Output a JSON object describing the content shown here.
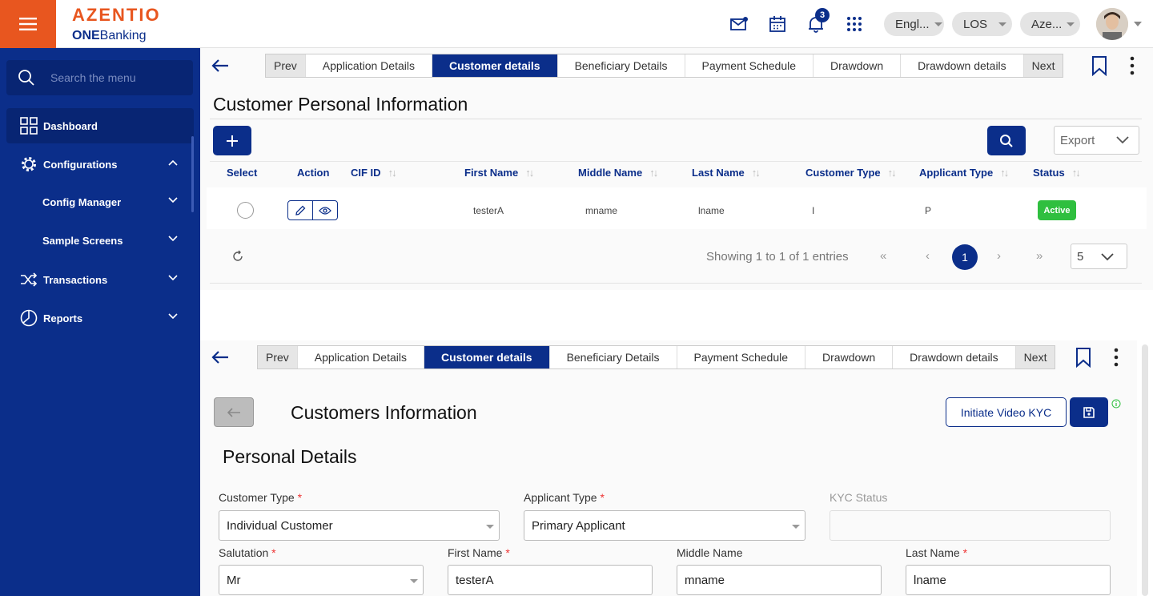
{
  "brand": {
    "name": "AZENTIO",
    "product_prefix": "ONE",
    "product_suffix": "Banking",
    "color": "#e8561f"
  },
  "topbar": {
    "notification_count": "3",
    "language": "Engl...",
    "module": "LOS",
    "entity": "Aze..."
  },
  "sidebar": {
    "search_placeholder": "Search the menu",
    "items": [
      {
        "label": "Dashboard"
      },
      {
        "label": "Configurations"
      },
      {
        "label": "Config Manager"
      },
      {
        "label": "Sample Screens"
      },
      {
        "label": "Transactions"
      },
      {
        "label": "Reports"
      }
    ]
  },
  "tabs": {
    "prev": "Prev",
    "next": "Next",
    "items": [
      "Application Details",
      "Customer details",
      "Beneficiary Details",
      "Payment Schedule",
      "Drawdown",
      "Drawdown details"
    ],
    "active": "Customer details"
  },
  "list_section": {
    "title": "Customer Personal Information",
    "export_label": "Export",
    "columns": [
      "Select",
      "Action",
      "CIF ID",
      "First Name",
      "Middle Name",
      "Last Name",
      "Customer Type",
      "Applicant Type",
      "Status"
    ],
    "rows": [
      {
        "cif_id": "",
        "first_name": "testerA",
        "middle_name": "mname",
        "last_name": "lname",
        "customer_type": "I",
        "applicant_type": "P",
        "status": "Active"
      }
    ],
    "showing": "Showing 1 to 1 of 1 entries",
    "current_page": "1",
    "page_size": "5"
  },
  "form_section": {
    "title": "Customers Information",
    "video_kyc_label": "Initiate Video KYC",
    "personal_details": "Personal Details",
    "fields": {
      "customer_type": {
        "label": "Customer Type",
        "value": "Individual Customer"
      },
      "applicant_type": {
        "label": "Applicant Type",
        "value": "Primary Applicant"
      },
      "kyc_status": {
        "label": "KYC Status",
        "value": ""
      },
      "salutation": {
        "label": "Salutation",
        "value": "Mr"
      },
      "first_name": {
        "label": "First Name",
        "value": "testerA"
      },
      "middle_name": {
        "label": "Middle Name",
        "value": "mname"
      },
      "last_name": {
        "label": "Last Name",
        "value": "lname"
      }
    },
    "required_mark": "*"
  },
  "colors": {
    "primary": "#0b2e8a",
    "accent": "#e8561f",
    "active_badge": "#2fbf3f"
  }
}
